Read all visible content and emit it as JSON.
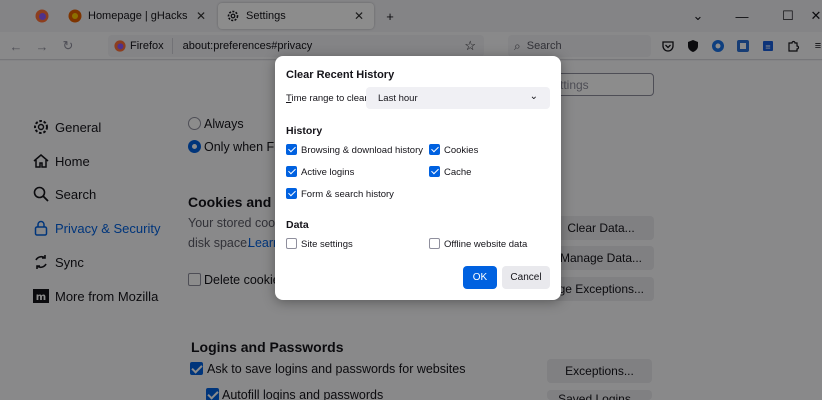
{
  "tabs": [
    {
      "title": "",
      "icon": "firefox-icon"
    },
    {
      "title": "Homepage | gHacks Technolog",
      "icon": "ghacks-favicon-icon"
    },
    {
      "title": "Settings",
      "icon": "gear-icon"
    }
  ],
  "urlbar": {
    "identity": "Firefox",
    "url": "about:preferences#privacy"
  },
  "search": {
    "placeholder": "Search"
  },
  "find_placeholder": "ttings",
  "sidebar": {
    "items": [
      {
        "label": "General",
        "icon": "gear-icon"
      },
      {
        "label": "Home",
        "icon": "home-icon"
      },
      {
        "label": "Search",
        "icon": "search-icon"
      },
      {
        "label": "Privacy & Security",
        "icon": "lock-icon"
      },
      {
        "label": "Sync",
        "icon": "sync-icon"
      },
      {
        "label": "More from Mozilla",
        "icon": "mozilla-icon"
      }
    ]
  },
  "main": {
    "history_radio_always": "Always",
    "history_radio_only": "Only when Firef",
    "cookies_heading": "Cookies and Site",
    "cookies_text_1": "Your stored cookie",
    "cookies_text_2": "disk space.",
    "cookies_link": "Learn",
    "delete_cookies": "Delete cookies",
    "clear_data_btn": "Clear Data...",
    "manage_data_btn": "Manage Data...",
    "manage_exceptions_btn": "age Exceptions...",
    "logins_heading": "Logins and Passwords",
    "ask_save_logins": "Ask to save logins and passwords for websites",
    "autofill_logins": "Autofill logins and passwords",
    "exceptions_btn": "Exceptions...",
    "saved_logins_btn": "Saved Logins..."
  },
  "dialog": {
    "title": "Clear Recent History",
    "time_range_label": "Time range to clear:",
    "time_range_value": "Last hour",
    "history_heading": "History",
    "history_items": [
      {
        "label": "Browsing & download history",
        "checked": true
      },
      {
        "label": "Cookies",
        "checked": true
      },
      {
        "label": "Active logins",
        "checked": true
      },
      {
        "label": "Cache",
        "checked": true
      },
      {
        "label": "Form & search history",
        "checked": true
      }
    ],
    "data_heading": "Data",
    "data_items": [
      {
        "label": "Site settings",
        "checked": false
      },
      {
        "label": "Offline website data",
        "checked": false
      }
    ],
    "ok_label": "OK",
    "cancel_label": "Cancel"
  },
  "colors": {
    "accent": "#0061e0",
    "overlay": "rgba(0,0,0,0.45)"
  }
}
